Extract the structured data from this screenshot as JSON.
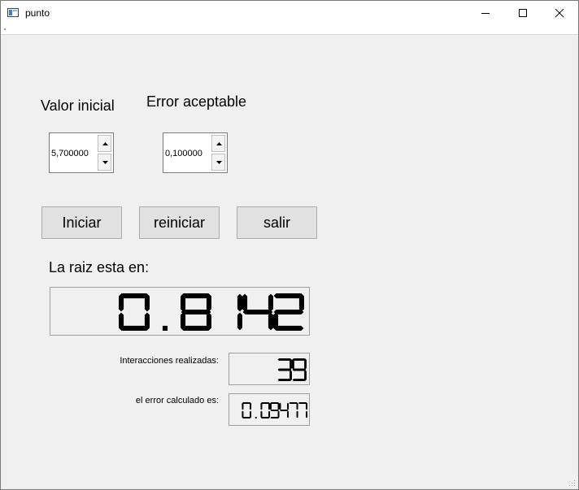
{
  "window": {
    "title": "punto",
    "app_icon": "window-app-icon"
  },
  "controls": {
    "minimize": "minimize-icon",
    "maximize": "maximize-icon",
    "close": "close-icon"
  },
  "labels": {
    "valor_inicial": "Valor inicial",
    "error_aceptable": "Error aceptable",
    "raiz": "La raiz esta en:",
    "interacciones": "Interacciones realizadas:",
    "error_calculado": "el error calculado es:"
  },
  "inputs": {
    "valor_inicial": "5,700000",
    "error_aceptable": "0,100000"
  },
  "buttons": {
    "iniciar": "Iniciar",
    "reiniciar": "reiniciar",
    "salir": "salir"
  },
  "displays": {
    "raiz": "0.8142",
    "interacciones": "39",
    "error": "0.09477"
  }
}
